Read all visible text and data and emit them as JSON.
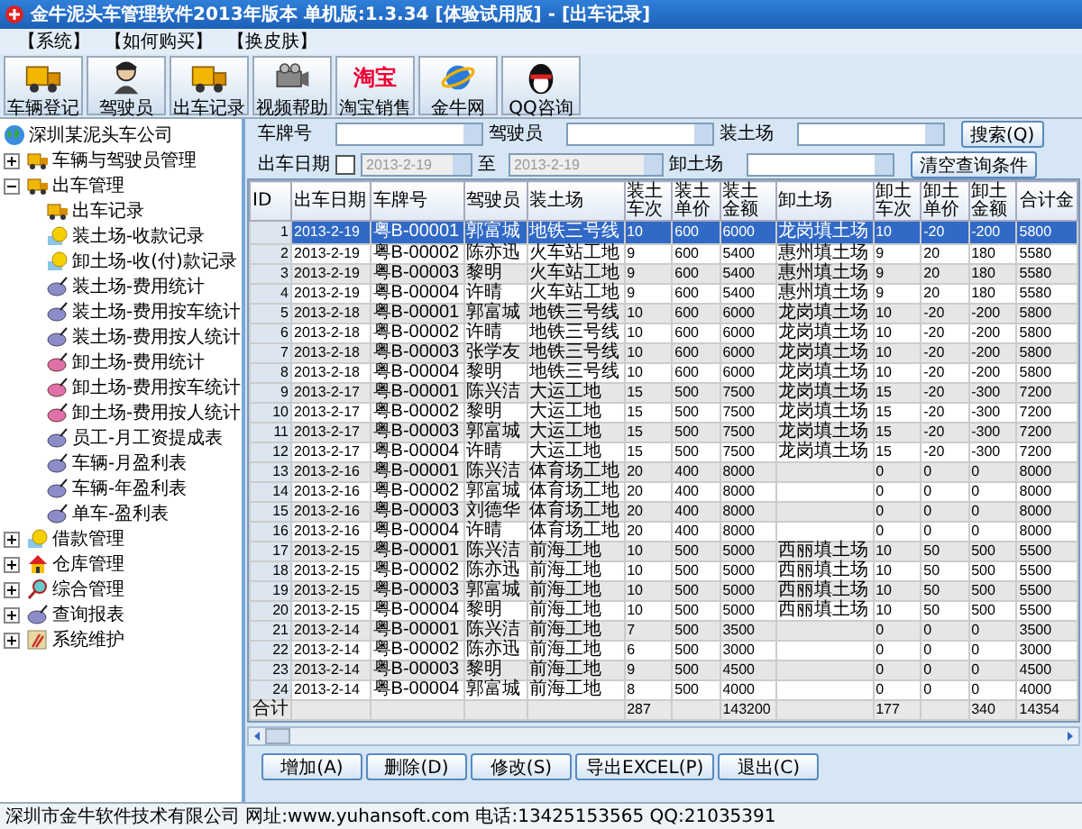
{
  "window": {
    "title": "金牛泥头车管理软件2013年版本 单机版:1.3.34 [体验试用版] - [出车记录]"
  },
  "menu": [
    "【系统】",
    "【如何购买】",
    "【换皮肤】"
  ],
  "toolbar": [
    {
      "label": "车辆登记",
      "kind": "truck"
    },
    {
      "label": "驾驶员",
      "kind": "person"
    },
    {
      "label": "出车记录",
      "kind": "truck"
    },
    {
      "label": "视频帮助",
      "kind": "projector"
    },
    {
      "label": "淘宝销售",
      "kind": "logo",
      "logo_text": "淘宝"
    },
    {
      "label": "金牛网",
      "kind": "globe"
    },
    {
      "label": "QQ咨询",
      "kind": "penguin"
    }
  ],
  "sidebar": {
    "tree": [
      {
        "label": "深圳某泥头车公司",
        "kind": "globe",
        "children": [
          {
            "label": "车辆与驾驶员管理",
            "kind": "truck",
            "expanded": false
          },
          {
            "label": "出车管理",
            "kind": "truck",
            "expanded": true,
            "children": [
              {
                "label": "出车记录",
                "kind": "truck"
              },
              {
                "label": "装土场-收款记录",
                "kind": "money"
              },
              {
                "label": "卸土场-收(付)款记录",
                "kind": "money"
              },
              {
                "label": "装土场-费用统计",
                "kind": "disc"
              },
              {
                "label": "装土场-费用按车统计",
                "kind": "disc"
              },
              {
                "label": "装土场-费用按人统计",
                "kind": "disc"
              },
              {
                "label": "卸土场-费用统计",
                "kind": "disc-alt"
              },
              {
                "label": "卸土场-费用按车统计",
                "kind": "disc-alt"
              },
              {
                "label": "卸土场-费用按人统计",
                "kind": "disc-alt"
              },
              {
                "label": "员工-月工资提成表",
                "kind": "disc"
              },
              {
                "label": "车辆-月盈利表",
                "kind": "disc"
              },
              {
                "label": "车辆-年盈利表",
                "kind": "disc"
              },
              {
                "label": "单车-盈利表",
                "kind": "disc"
              }
            ]
          },
          {
            "label": "借款管理",
            "kind": "money",
            "expanded": false
          },
          {
            "label": "仓库管理",
            "kind": "house",
            "expanded": false
          },
          {
            "label": "综合管理",
            "kind": "magnifier",
            "expanded": false
          },
          {
            "label": "查询报表",
            "kind": "disc",
            "expanded": false
          },
          {
            "label": "系统维护",
            "kind": "tools",
            "expanded": false
          }
        ]
      }
    ]
  },
  "filters": {
    "plate": {
      "label": "车牌号"
    },
    "driver": {
      "label": "驾驶员"
    },
    "load_site": {
      "label": "装土场"
    },
    "date_label": "出车日期",
    "date_checkbox": {
      "checked": false
    },
    "date_from": {
      "value": "2013-2-19",
      "disabled": true
    },
    "to_label": "至",
    "date_to": {
      "value": "2013-2-19",
      "disabled": true
    },
    "unload_site": {
      "label": "卸土场"
    },
    "search_button": "搜索(Q)",
    "clear_button": "清空查询条件"
  },
  "table": {
    "columns": [
      "ID",
      "出车日期",
      "车牌号",
      "驾驶员",
      "装土场",
      "装土车次",
      "装土单价",
      "装土金额",
      "卸土场",
      "卸土车次",
      "卸土单价",
      "卸土金额",
      "合计金"
    ],
    "rows": [
      {
        "selected": true,
        "cells": [
          "1",
          "2013-2-19",
          "粤B-00001",
          "郭富城",
          "地铁三号线",
          "10",
          "600",
          "6000",
          "龙岗填土场",
          "10",
          "-20",
          "-200",
          "5800"
        ]
      },
      {
        "selected": false,
        "cells": [
          "2",
          "2013-2-19",
          "粤B-00002",
          "陈亦迅",
          "火车站工地",
          "9",
          "600",
          "5400",
          "惠州填土场",
          "9",
          "20",
          "180",
          "5580"
        ]
      },
      {
        "selected": false,
        "cells": [
          "3",
          "2013-2-19",
          "粤B-00003",
          "黎明",
          "火车站工地",
          "9",
          "600",
          "5400",
          "惠州填土场",
          "9",
          "20",
          "180",
          "5580"
        ]
      },
      {
        "selected": false,
        "cells": [
          "4",
          "2013-2-19",
          "粤B-00004",
          "许晴",
          "火车站工地",
          "9",
          "600",
          "5400",
          "惠州填土场",
          "9",
          "20",
          "180",
          "5580"
        ]
      },
      {
        "selected": false,
        "cells": [
          "5",
          "2013-2-18",
          "粤B-00001",
          "郭富城",
          "地铁三号线",
          "10",
          "600",
          "6000",
          "龙岗填土场",
          "10",
          "-20",
          "-200",
          "5800"
        ]
      },
      {
        "selected": false,
        "cells": [
          "6",
          "2013-2-18",
          "粤B-00002",
          "许晴",
          "地铁三号线",
          "10",
          "600",
          "6000",
          "龙岗填土场",
          "10",
          "-20",
          "-200",
          "5800"
        ]
      },
      {
        "selected": false,
        "cells": [
          "7",
          "2013-2-18",
          "粤B-00003",
          "张学友",
          "地铁三号线",
          "10",
          "600",
          "6000",
          "龙岗填土场",
          "10",
          "-20",
          "-200",
          "5800"
        ]
      },
      {
        "selected": false,
        "cells": [
          "8",
          "2013-2-18",
          "粤B-00004",
          "黎明",
          "地铁三号线",
          "10",
          "600",
          "6000",
          "龙岗填土场",
          "10",
          "-20",
          "-200",
          "5800"
        ]
      },
      {
        "selected": false,
        "cells": [
          "9",
          "2013-2-17",
          "粤B-00001",
          "陈兴洁",
          "大运工地",
          "15",
          "500",
          "7500",
          "龙岗填土场",
          "15",
          "-20",
          "-300",
          "7200"
        ]
      },
      {
        "selected": false,
        "cells": [
          "10",
          "2013-2-17",
          "粤B-00002",
          "黎明",
          "大运工地",
          "15",
          "500",
          "7500",
          "龙岗填土场",
          "15",
          "-20",
          "-300",
          "7200"
        ]
      },
      {
        "selected": false,
        "cells": [
          "11",
          "2013-2-17",
          "粤B-00003",
          "郭富城",
          "大运工地",
          "15",
          "500",
          "7500",
          "龙岗填土场",
          "15",
          "-20",
          "-300",
          "7200"
        ]
      },
      {
        "selected": false,
        "cells": [
          "12",
          "2013-2-17",
          "粤B-00004",
          "许晴",
          "大运工地",
          "15",
          "500",
          "7500",
          "龙岗填土场",
          "15",
          "-20",
          "-300",
          "7200"
        ]
      },
      {
        "selected": false,
        "cells": [
          "13",
          "2013-2-16",
          "粤B-00001",
          "陈兴洁",
          "体育场工地",
          "20",
          "400",
          "8000",
          "",
          "0",
          "0",
          "0",
          "8000"
        ]
      },
      {
        "selected": false,
        "cells": [
          "14",
          "2013-2-16",
          "粤B-00002",
          "郭富城",
          "体育场工地",
          "20",
          "400",
          "8000",
          "",
          "0",
          "0",
          "0",
          "8000"
        ]
      },
      {
        "selected": false,
        "cells": [
          "15",
          "2013-2-16",
          "粤B-00003",
          "刘德华",
          "体育场工地",
          "20",
          "400",
          "8000",
          "",
          "0",
          "0",
          "0",
          "8000"
        ]
      },
      {
        "selected": false,
        "cells": [
          "16",
          "2013-2-16",
          "粤B-00004",
          "许晴",
          "体育场工地",
          "20",
          "400",
          "8000",
          "",
          "0",
          "0",
          "0",
          "8000"
        ]
      },
      {
        "selected": false,
        "cells": [
          "17",
          "2013-2-15",
          "粤B-00001",
          "陈兴洁",
          "前海工地",
          "10",
          "500",
          "5000",
          "西丽填土场",
          "10",
          "50",
          "500",
          "5500"
        ]
      },
      {
        "selected": false,
        "cells": [
          "18",
          "2013-2-15",
          "粤B-00002",
          "陈亦迅",
          "前海工地",
          "10",
          "500",
          "5000",
          "西丽填土场",
          "10",
          "50",
          "500",
          "5500"
        ]
      },
      {
        "selected": false,
        "cells": [
          "19",
          "2013-2-15",
          "粤B-00003",
          "郭富城",
          "前海工地",
          "10",
          "500",
          "5000",
          "西丽填土场",
          "10",
          "50",
          "500",
          "5500"
        ]
      },
      {
        "selected": false,
        "cells": [
          "20",
          "2013-2-15",
          "粤B-00004",
          "黎明",
          "前海工地",
          "10",
          "500",
          "5000",
          "西丽填土场",
          "10",
          "50",
          "500",
          "5500"
        ]
      },
      {
        "selected": false,
        "cells": [
          "21",
          "2013-2-14",
          "粤B-00001",
          "陈兴洁",
          "前海工地",
          "7",
          "500",
          "3500",
          "",
          "0",
          "0",
          "0",
          "3500"
        ]
      },
      {
        "selected": false,
        "cells": [
          "22",
          "2013-2-14",
          "粤B-00002",
          "陈亦迅",
          "前海工地",
          "6",
          "500",
          "3000",
          "",
          "0",
          "0",
          "0",
          "3000"
        ]
      },
      {
        "selected": false,
        "cells": [
          "23",
          "2013-2-14",
          "粤B-00003",
          "黎明",
          "前海工地",
          "9",
          "500",
          "4500",
          "",
          "0",
          "0",
          "0",
          "4500"
        ]
      },
      {
        "selected": false,
        "cells": [
          "24",
          "2013-2-14",
          "粤B-00004",
          "郭富城",
          "前海工地",
          "8",
          "500",
          "4000",
          "",
          "0",
          "0",
          "0",
          "4000"
        ]
      }
    ],
    "totals": {
      "label": "合计",
      "load_trips": "287",
      "load_amount": "143200",
      "unload_trips": "177",
      "unload_amount": "340",
      "total": "14354"
    }
  },
  "buttons": [
    "增加(A)",
    "删除(D)",
    "修改(S)",
    "导出EXCEL(P)",
    "退出(C)"
  ],
  "status_bar": "深圳市金牛软件技术有限公司 网址:www.yuhansoft.com 电话:13425153565 QQ:21035391"
}
